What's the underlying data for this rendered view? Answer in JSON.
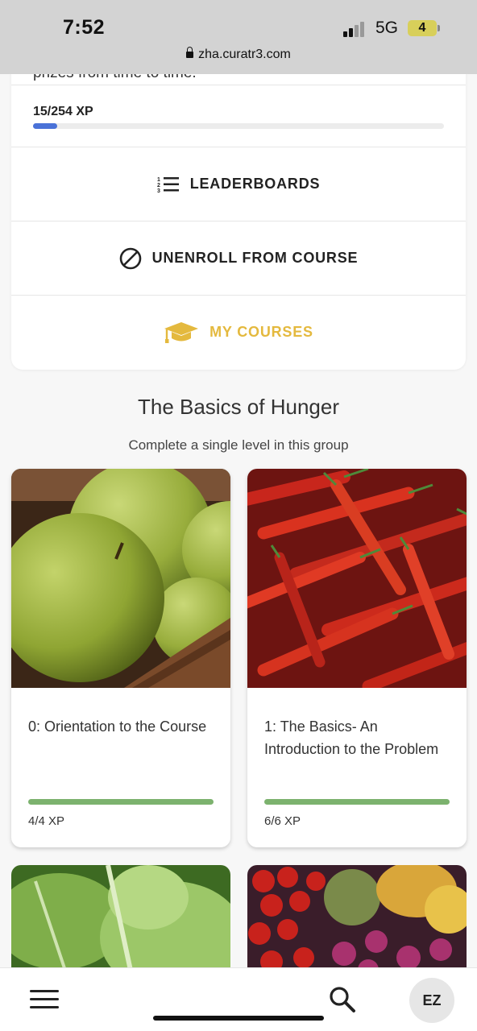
{
  "status_bar": {
    "time": "7:52",
    "network": "5G",
    "battery": "4",
    "url": "zha.curatr3.com"
  },
  "top_card": {
    "cut_text": "prizes from time to time.",
    "xp_label": "15/254 XP",
    "xp_progress": 0.059,
    "leaderboards_label": "LEADERBOARDS",
    "unenroll_label": "UNENROLL FROM COURSE",
    "my_courses_label": "MY COURSES"
  },
  "section": {
    "title": "The Basics of Hunger",
    "subtitle": "Complete a single level in this group"
  },
  "courses": [
    {
      "title": "0: Orientation to the Course",
      "xp": "4/4 XP",
      "progress": 1.0,
      "image": "green-apples"
    },
    {
      "title": "1: The Basics- An Introduction to the Problem",
      "xp": "6/6 XP",
      "progress": 1.0,
      "image": "red-chili-peppers"
    }
  ],
  "more_courses": [
    {
      "image": "lettuce-leaves"
    },
    {
      "image": "vegetables-tomatoes-onions"
    }
  ],
  "bottom_bar": {
    "avatar_initials": "EZ",
    "icons": [
      "menu-icon",
      "search-icon"
    ]
  },
  "colors": {
    "xp_fill": "#4a72d8",
    "course_progress": "#7cb26e",
    "gold": "#e4b93e"
  }
}
